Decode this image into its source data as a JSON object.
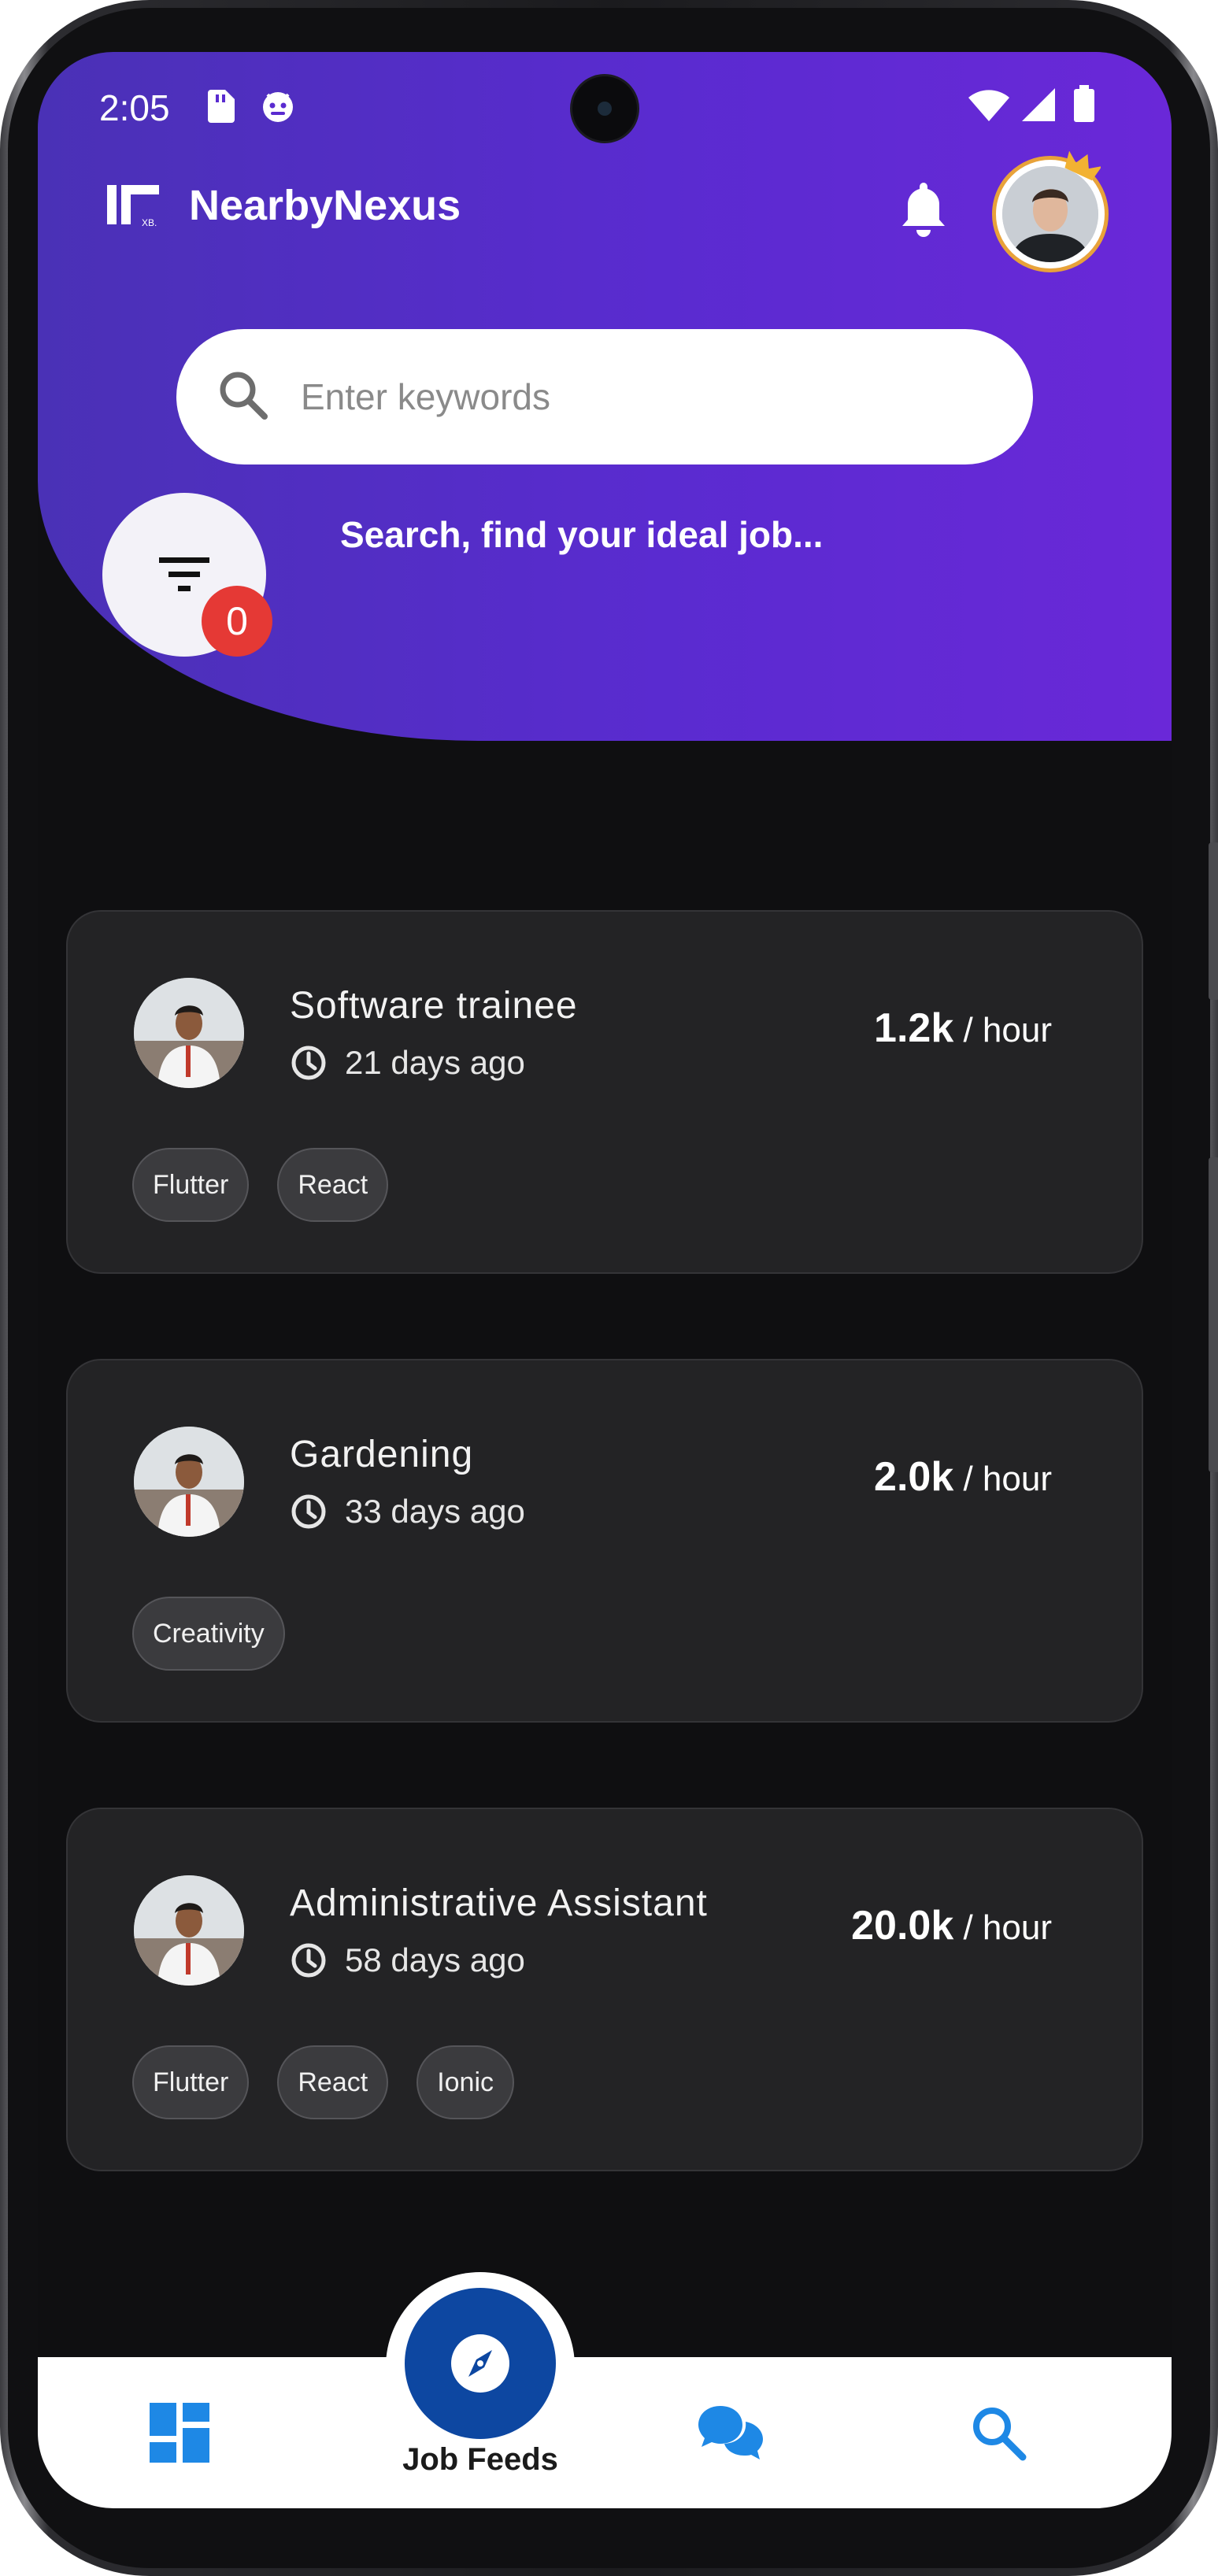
{
  "status_bar": {
    "time": "2:05"
  },
  "header": {
    "app_name": "NearbyNexus",
    "search_placeholder": "Enter keywords",
    "filter_count": "0",
    "tagline": "Search, find your ideal job..."
  },
  "jobs": [
    {
      "title": "Software trainee",
      "posted": "21 days ago",
      "rate_value": "1.2k",
      "rate_unit": "/ hour",
      "tags": [
        "Flutter",
        "React"
      ]
    },
    {
      "title": "Gardening",
      "posted": "33 days ago",
      "rate_value": "2.0k",
      "rate_unit": "/ hour",
      "tags": [
        "Creativity"
      ]
    },
    {
      "title": "Administrative Assistant",
      "posted": "58 days ago",
      "rate_value": "20.0k",
      "rate_unit": "/ hour",
      "tags": [
        "Flutter",
        "React",
        "Ionic"
      ]
    }
  ],
  "bottom_nav": {
    "center_label": "Job Feeds",
    "items": [
      "dashboard-icon",
      "compass-icon",
      "chat-icon",
      "search-icon"
    ]
  },
  "colors": {
    "header_start": "#4a31b6",
    "header_end": "#6a28d8",
    "card_bg": "#232325",
    "badge": "#e53935",
    "fab": "#0d47a1",
    "nav_icon": "#1e88e5"
  }
}
